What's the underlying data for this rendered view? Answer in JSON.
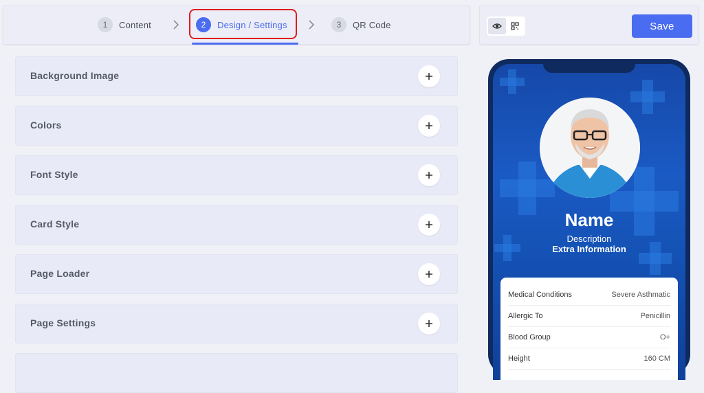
{
  "stepper": {
    "steps": [
      {
        "number": "1",
        "label": "Content"
      },
      {
        "number": "2",
        "label": "Design / Settings"
      },
      {
        "number": "3",
        "label": "QR Code"
      }
    ],
    "active_step": 2
  },
  "accordions": [
    {
      "title": "Background Image"
    },
    {
      "title": "Colors"
    },
    {
      "title": "Font Style"
    },
    {
      "title": "Card Style"
    },
    {
      "title": "Page Loader"
    },
    {
      "title": "Page Settings"
    }
  ],
  "toolbar": {
    "save_label": "Save",
    "view_modes": [
      "eye-icon",
      "qr-code-icon"
    ],
    "active_view": "eye-icon"
  },
  "preview": {
    "name": "Name",
    "description": "Description",
    "extra": "Extra Information",
    "info_rows": [
      {
        "label": "Medical Conditions",
        "value": "Severe Asthmatic"
      },
      {
        "label": "Allergic To",
        "value": "Penicillin"
      },
      {
        "label": "Blood Group",
        "value": "O+"
      },
      {
        "label": "Height",
        "value": "160 CM"
      }
    ]
  },
  "colors": {
    "accent": "#4a6cf0",
    "highlight_border": "#e01b1b",
    "phone_frame": "#0f2a5e",
    "screen_bg": "#1a5ac4"
  }
}
